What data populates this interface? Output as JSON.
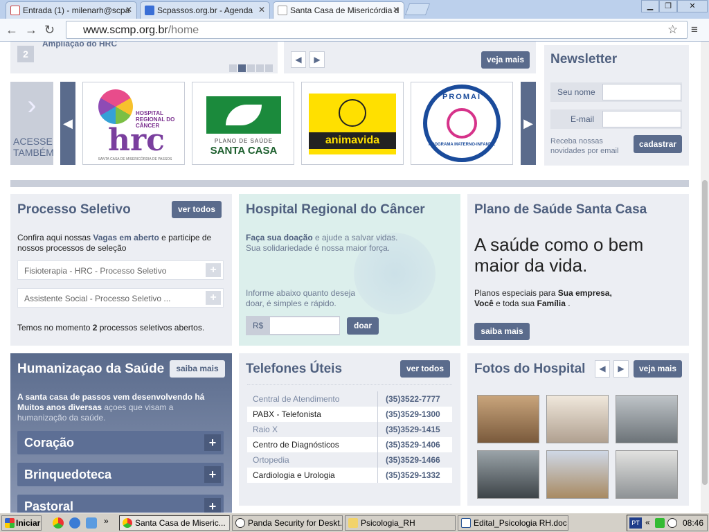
{
  "browser": {
    "tabs": [
      {
        "label": "Entrada (1) - milenarh@scpa",
        "icon": "gmail-icon"
      },
      {
        "label": "Scpassos.org.br - Agenda",
        "icon": "calendar-icon"
      },
      {
        "label": "Santa Casa de Misericórdia d",
        "icon": "page-icon"
      }
    ],
    "url_host": "www.scmp.org.br",
    "url_path": "/home"
  },
  "banner": {
    "slide_number": "2",
    "slide_title": "Ampliação do HRC",
    "more_label": "veja mais"
  },
  "partners": {
    "label": "ACESSE TAMBÉM",
    "logos": [
      {
        "line1": "HOSPITAL REGIONAL DO CÂNCER",
        "line2": "hrc",
        "line3": "SANTA CASA DE MISERICÓRDIA DE PASSOS"
      },
      {
        "line1": "PLANO DE SAÚDE",
        "line2": "SANTA CASA"
      },
      {
        "line1": "animavida"
      },
      {
        "line1": "PROMAI",
        "line2": "PROGRAMA MATERNO-INFANTIL"
      }
    ]
  },
  "newsletter": {
    "title": "Newsletter",
    "name_label": "Seu nome",
    "email_label": "E-mail",
    "note": "Receba nossas novidades por email",
    "button": "cadastrar"
  },
  "processo": {
    "title": "Processo Seletivo",
    "button": "ver todos",
    "intro_a": "Confira aqui nossas ",
    "intro_link": "Vagas em aberto",
    "intro_b": " e participe de nossos processos de seleção",
    "items": [
      "Fisioterapia - HRC - Processo Seletivo",
      "Assistente Social - Processo Seletivo ..."
    ],
    "footer_a": "Temos no momento ",
    "footer_count": "2",
    "footer_b": " processos seletivos abertos."
  },
  "hrc": {
    "title": "Hospital Regional do Câncer",
    "line1_strong": "Faça sua doação",
    "line1_rest": " e ajude a salvar vidas.",
    "line2": "Sua solidariedade é nossa maior força.",
    "info": "Informe abaixo quanto deseja doar, é simples e rápido.",
    "currency": "R$",
    "button": "doar"
  },
  "plano": {
    "title": "Plano de Saúde Santa Casa",
    "headline": "A saúde como o bem maior da vida.",
    "desc_a": "Planos especiais para ",
    "desc_b": "Sua empresa,",
    "desc_c": "Você",
    "desc_d": " e toda sua ",
    "desc_e": "Família",
    "desc_f": " .",
    "button": "saiba mais"
  },
  "humanizacao": {
    "title": "Humanizaçao da Saúde",
    "button": "saiba mais",
    "text_a": "A santa casa de passos vem desenvolvendo há Muitos anos diversas",
    "text_b": " açoes que visam a humanização da saúde.",
    "items": [
      "Coração",
      "Brinquedoteca",
      "Pastoral"
    ]
  },
  "telefones": {
    "title": "Telefones Úteis",
    "button": "ver todos",
    "rows": [
      {
        "name": "Central de Atendimento",
        "number": "(35)3522-7777"
      },
      {
        "name": "PABX - Telefonista",
        "number": "(35)3529-1300"
      },
      {
        "name": "Raio X",
        "number": "(35)3529-1415"
      },
      {
        "name": "Centro de Diagnósticos",
        "number": "(35)3529-1406"
      },
      {
        "name": "Ortopedia",
        "number": "(35)3529-1466"
      },
      {
        "name": "Cardiologia e Urologia",
        "number": "(35)3529-1332"
      }
    ]
  },
  "fotos": {
    "title": "Fotos do Hospital",
    "button": "veja mais"
  },
  "taskbar": {
    "start": "Iniciar",
    "tasks": [
      "Santa Casa de Miseric...",
      "Panda Security for Deskt...",
      "Psicologia_RH",
      "Edital_Psicologia RH.doc ..."
    ],
    "lang": "PT",
    "clock": "08:46"
  }
}
